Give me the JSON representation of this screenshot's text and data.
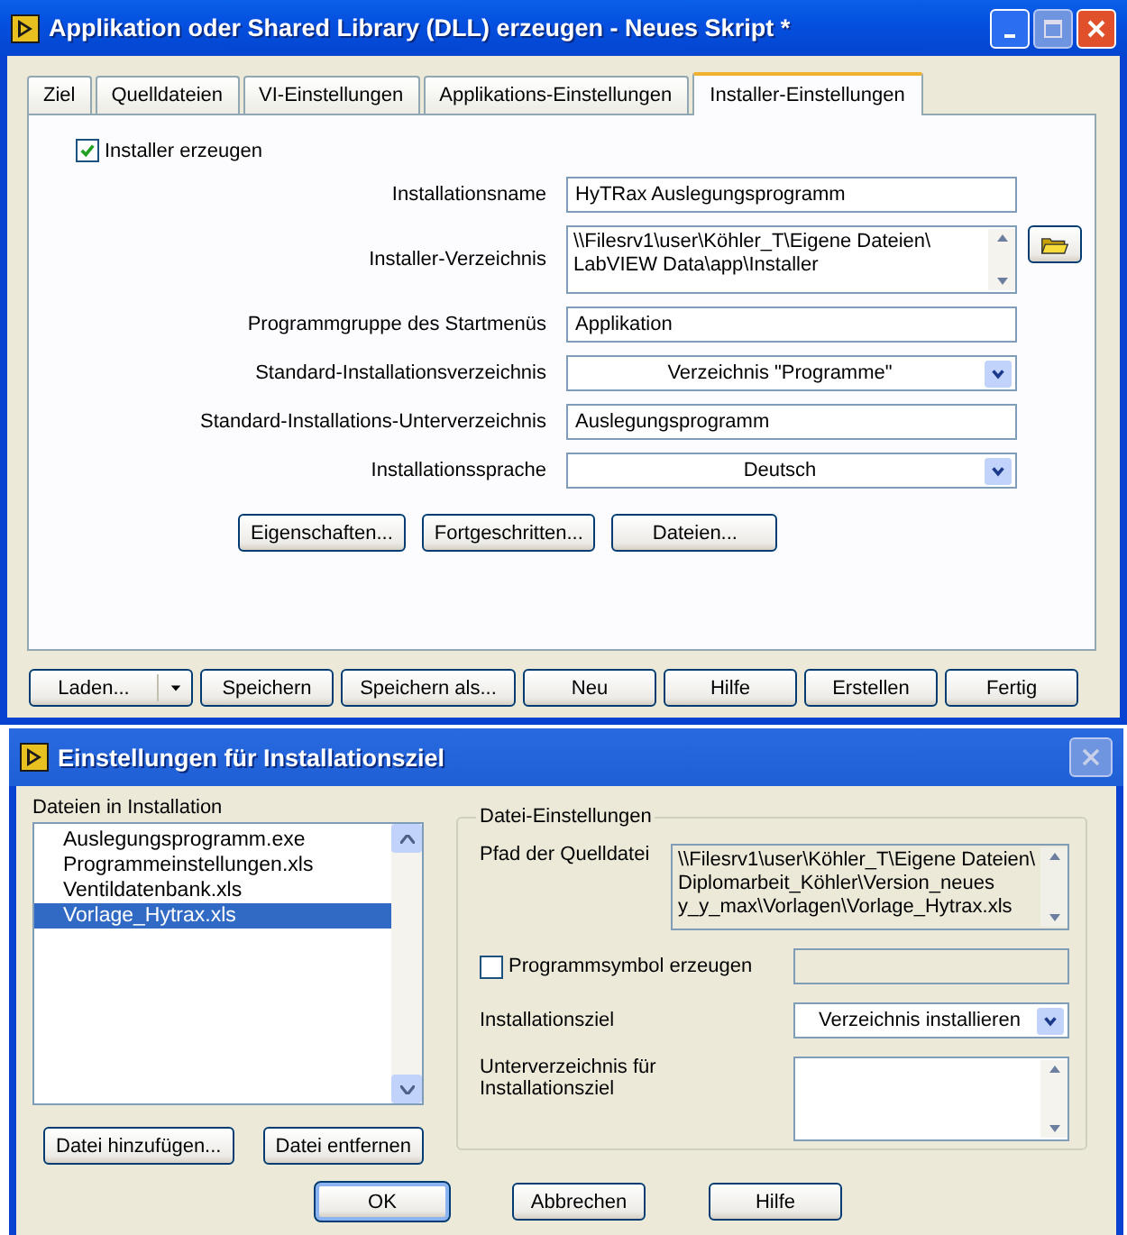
{
  "main_window": {
    "title": "Applikation oder Shared Library (DLL) erzeugen - Neues Skript *",
    "tabs": [
      {
        "label": "Ziel",
        "selected": false
      },
      {
        "label": "Quelldateien",
        "selected": false
      },
      {
        "label": "VI-Einstellungen",
        "selected": false
      },
      {
        "label": "Applikations-Einstellungen",
        "selected": false
      },
      {
        "label": "Installer-Einstellungen",
        "selected": true
      }
    ],
    "installer_checkbox": {
      "label": "Installer erzeugen",
      "checked": true
    },
    "fields": [
      {
        "kind": "text",
        "label": "Installationsname",
        "value": "HyTRax Auslegungsprogramm"
      },
      {
        "kind": "path",
        "label": "Installer-Verzeichnis",
        "lines": [
          "\\\\Filesrv1\\user\\Köhler_T\\Eigene Dateien\\",
          "LabVIEW Data\\app\\Installer"
        ]
      },
      {
        "kind": "text",
        "label": "Programmgruppe des Startmenüs",
        "value": "Applikation"
      },
      {
        "kind": "select",
        "label": "Standard-Installationsverzeichnis",
        "value": "Verzeichnis \"Programme\""
      },
      {
        "kind": "text",
        "label": "Standard-Installations-Unterverzeichnis",
        "value": "Auslegungsprogramm"
      },
      {
        "kind": "select",
        "label": "Installationssprache",
        "value": "Deutsch"
      }
    ],
    "panel_buttons": [
      "Eigenschaften...",
      "Fortgeschritten...",
      "Dateien..."
    ],
    "footer_buttons": [
      {
        "kind": "split",
        "label": "Laden..."
      },
      {
        "kind": "plain",
        "label": "Speichern"
      },
      {
        "kind": "plain",
        "label": "Speichern als..."
      },
      {
        "kind": "plain",
        "label": "Neu"
      },
      {
        "kind": "plain",
        "label": "Hilfe"
      },
      {
        "kind": "plain",
        "label": "Erstellen"
      },
      {
        "kind": "plain",
        "label": "Fertig"
      }
    ]
  },
  "dialog": {
    "title": "Einstellungen für Installationsziel",
    "files_label": "Dateien in Installation",
    "files": [
      {
        "name": "Auslegungsprogramm.exe",
        "selected": false
      },
      {
        "name": "Programmeinstellungen.xls",
        "selected": false
      },
      {
        "name": "Ventildatenbank.xls",
        "selected": false
      },
      {
        "name": "Vorlage_Hytrax.xls",
        "selected": true
      }
    ],
    "file_buttons": [
      "Datei hinzufügen...",
      "Datei entfernen"
    ],
    "group_title": "Datei-Einstellungen",
    "source_label": "Pfad der Quelldatei",
    "source_lines": [
      "\\\\Filesrv1\\user\\Köhler_T\\Eigene Dateien\\",
      "Diplomarbeit_Köhler\\Version_neues",
      "y_y_max\\Vorlagen\\Vorlage_Hytrax.xls"
    ],
    "icon_checkbox": {
      "label": "Programmsymbol erzeugen",
      "checked": false
    },
    "target_label": "Installationsziel",
    "target_value": "Verzeichnis installieren",
    "subdir_label": "Unterverzeichnis für Installationsziel",
    "buttons": [
      "OK",
      "Abbrechen",
      "Hilfe"
    ]
  }
}
